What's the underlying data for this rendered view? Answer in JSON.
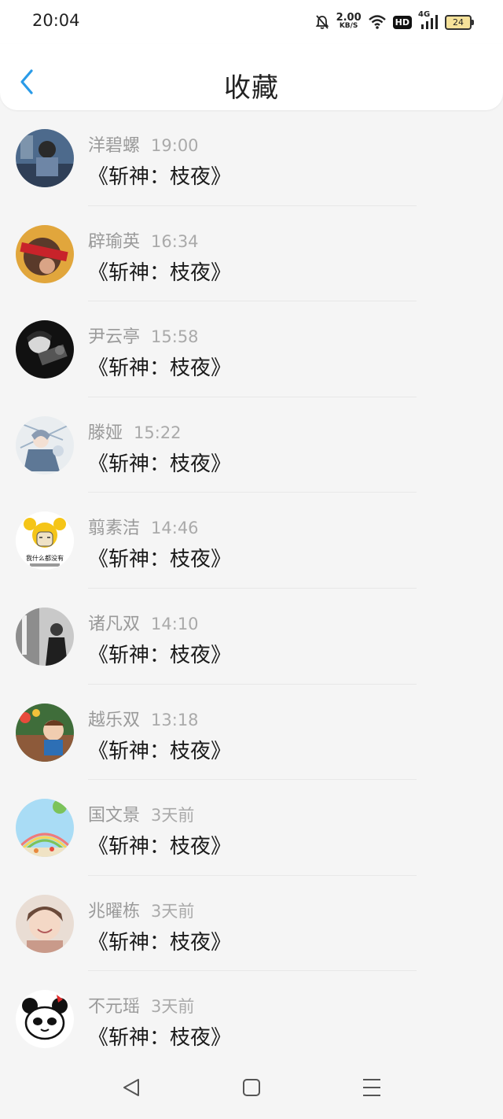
{
  "status": {
    "time": "20:04",
    "speed_value": "2.00",
    "speed_unit": "KB/S",
    "hd": "HD",
    "network": "4G",
    "battery": "24"
  },
  "header": {
    "title": "收藏"
  },
  "items": [
    {
      "name": "洋碧螺",
      "time": "19:00",
      "message": "《斩神：枝夜》"
    },
    {
      "name": "辟瑜英",
      "time": "16:34",
      "message": "《斩神：枝夜》"
    },
    {
      "name": "尹云亭",
      "time": "15:58",
      "message": "《斩神：枝夜》"
    },
    {
      "name": "滕娅",
      "time": "15:22",
      "message": "《斩神：枝夜》"
    },
    {
      "name": "翦素洁",
      "time": "14:46",
      "message": "《斩神：枝夜》"
    },
    {
      "name": "诸凡双",
      "time": "14:10",
      "message": "《斩神：枝夜》"
    },
    {
      "name": "越乐双",
      "time": "13:18",
      "message": "《斩神：枝夜》"
    },
    {
      "name": "国文景",
      "time": "3天前",
      "message": "《斩神：枝夜》"
    },
    {
      "name": "兆曜栋",
      "time": "3天前",
      "message": "《斩神：枝夜》"
    },
    {
      "name": "不元瑶",
      "time": "3天前",
      "message": "《斩神：枝夜》"
    }
  ],
  "avatar_texts": {
    "meme_line1": "我什么都没有"
  },
  "colors": {
    "accent": "#2a9be8",
    "background": "#f5f5f5"
  },
  "icons": [
    "back-chevron-icon",
    "mute-bell-icon",
    "wifi-icon",
    "signal-icon",
    "battery-icon",
    "nav-back-icon",
    "nav-home-icon",
    "nav-menu-icon"
  ]
}
